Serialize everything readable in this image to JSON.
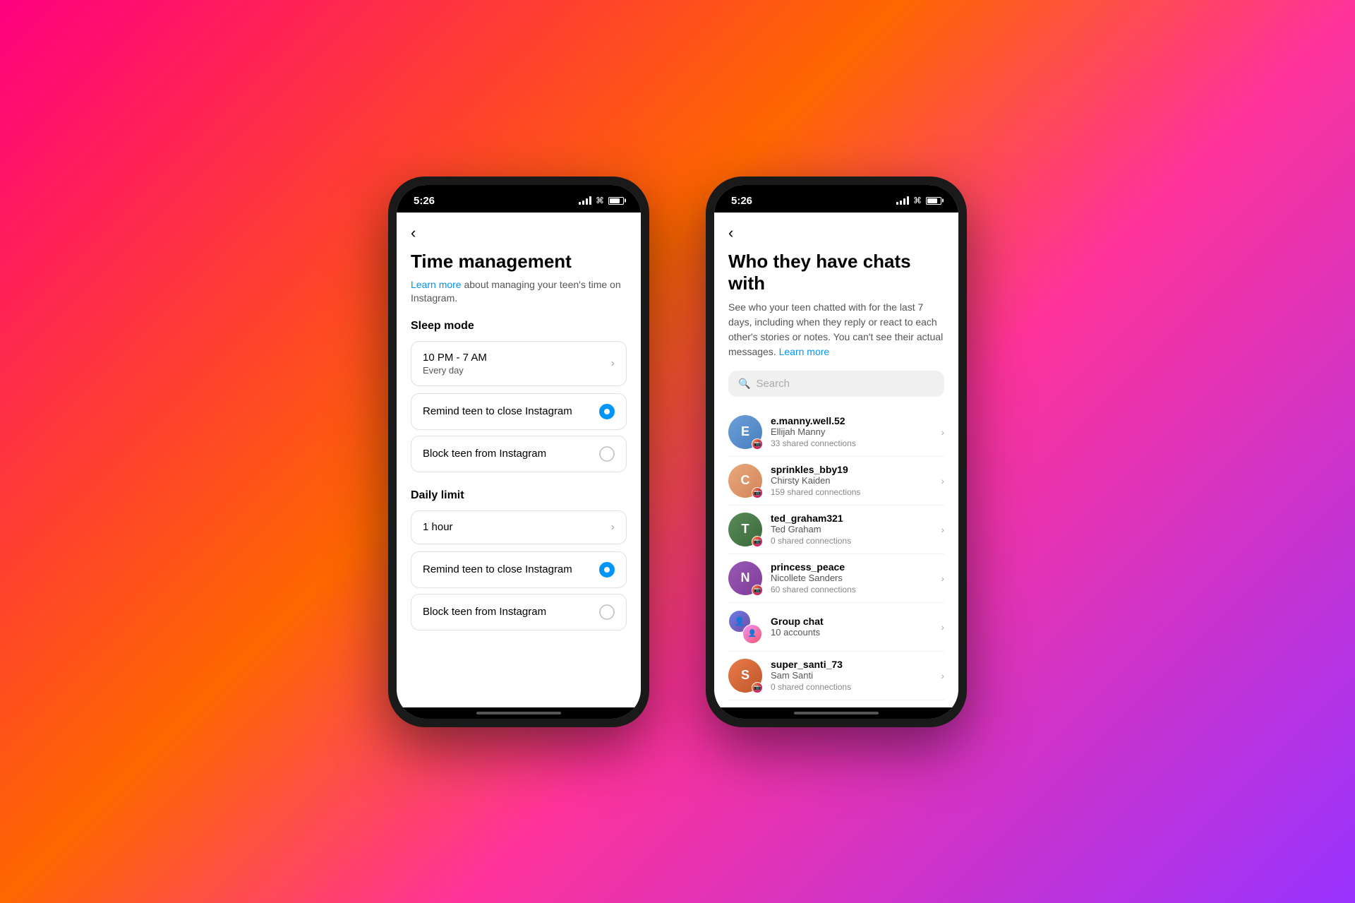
{
  "background": {
    "gradient": "linear-gradient(135deg, #ff0080 0%, #ff6600 40%, #ff3399 60%, #9933ff 100%)"
  },
  "phone_left": {
    "status_bar": {
      "time": "5:26"
    },
    "back_label": "‹",
    "page_title": "Time management",
    "learn_more_prefix": "",
    "learn_more_link_text": "Learn more",
    "learn_more_suffix": " about managing your teen's time on Instagram.",
    "sleep_mode_label": "Sleep mode",
    "sleep_schedule": {
      "time_range": "10 PM - 7 AM",
      "frequency": "Every day"
    },
    "sleep_options": [
      {
        "label": "Remind teen to close Instagram",
        "selected": true
      },
      {
        "label": "Block teen from Instagram",
        "selected": false
      }
    ],
    "daily_limit_label": "Daily limit",
    "daily_limit_value": "1 hour",
    "daily_options": [
      {
        "label": "Remind teen to close Instagram",
        "selected": true
      },
      {
        "label": "Block teen from Instagram",
        "selected": false
      }
    ]
  },
  "phone_right": {
    "status_bar": {
      "time": "5:26"
    },
    "back_label": "‹",
    "page_title": "Who they have chats with",
    "description": "See who your teen chatted with for the last 7 days, including when they reply or react to each other's stories or notes. You can't see their actual messages.",
    "learn_more_link_text": "Learn more",
    "search_placeholder": "Search",
    "contacts": [
      {
        "username": "e.manny.well.52",
        "real_name": "Ellijah Manny",
        "connections": "33 shared connections",
        "avatar_color": "#6a9fd8",
        "initials": "E",
        "has_ig_badge": true
      },
      {
        "username": "sprinkles_bby19",
        "real_name": "Chirsty Kaiden",
        "connections": "159 shared connections",
        "avatar_color": "#e8a87c",
        "initials": "C",
        "has_ig_badge": true
      },
      {
        "username": "ted_graham321",
        "real_name": "Ted Graham",
        "connections": "0 shared connections",
        "avatar_color": "#5a8a5a",
        "initials": "T",
        "has_ig_badge": true
      },
      {
        "username": "princess_peace",
        "real_name": "Nicollete Sanders",
        "connections": "60 shared connections",
        "avatar_color": "#8b6daa",
        "initials": "N",
        "has_ig_badge": true
      },
      {
        "username": "Group chat",
        "real_name": "10 accounts",
        "connections": "",
        "is_group": true
      },
      {
        "username": "super_santi_73",
        "real_name": "Sam Santi",
        "connections": "0 shared connections",
        "avatar_color": "#e87c4a",
        "initials": "S",
        "has_ig_badge": true
      }
    ]
  }
}
